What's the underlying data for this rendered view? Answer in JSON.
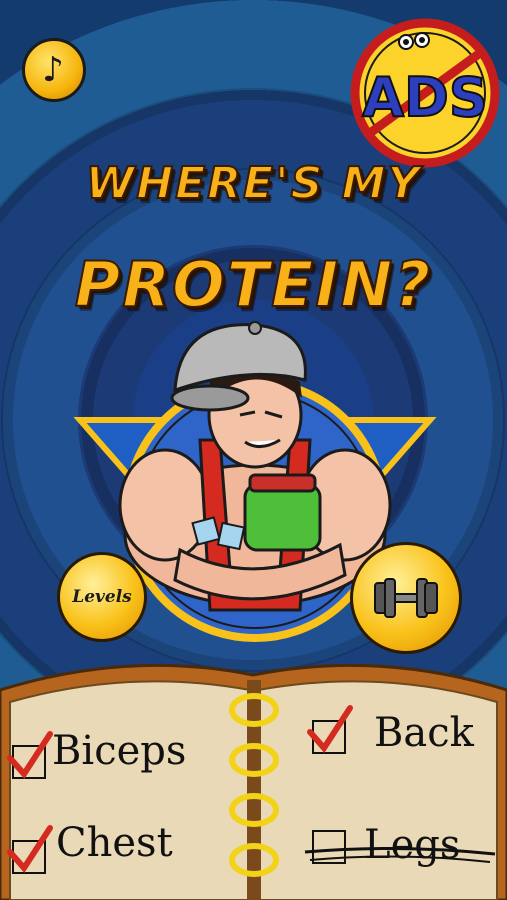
{
  "title": {
    "line1": "WHERE'S MY",
    "line2": "PROTEIN?"
  },
  "logo": {
    "text": "ADS",
    "icon": "ads-logo-icon"
  },
  "buttons": {
    "music": {
      "icon": "music-note-icon",
      "glyph": "♪"
    },
    "levels": {
      "label": "Levels"
    },
    "workout": {
      "icon": "dumbbell-icon"
    }
  },
  "workouts": [
    {
      "label": "Biceps",
      "checked": true
    },
    {
      "label": "Back",
      "checked": true
    },
    {
      "label": "Chest",
      "checked": true
    },
    {
      "label": "Legs",
      "checked": false,
      "crossed_out": true
    }
  ],
  "colors": {
    "title": "#f9b11a",
    "accent_red": "#d42a1f",
    "button_yellow": "#f9c21a",
    "notebook": "#e9d8b5"
  }
}
